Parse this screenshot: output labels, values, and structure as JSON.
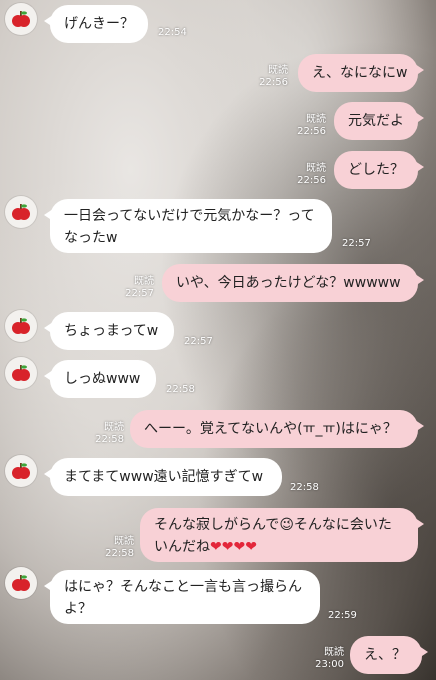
{
  "read_label": "既読",
  "messages": [
    {
      "side": "in",
      "text": "げんきー？",
      "time": "22:54"
    },
    {
      "side": "out",
      "text": "え、なになにw",
      "time": "22:56",
      "read": true
    },
    {
      "side": "out",
      "text": "元気だよ",
      "time": "22:56",
      "read": true
    },
    {
      "side": "out",
      "text": "どした？",
      "time": "22:56",
      "read": true
    },
    {
      "side": "in",
      "text": "一日会ってないだけで元気かなー？ってなったw",
      "time": "22:57"
    },
    {
      "side": "out",
      "text": "いや、今日あったけどな？wwwww",
      "time": "22:57",
      "read": true
    },
    {
      "side": "in",
      "text": "ちょっまってw",
      "time": "22:57"
    },
    {
      "side": "in",
      "text": "しっぬwww",
      "time": "22:58"
    },
    {
      "side": "out",
      "text": "へーー。覚えてないんや(ㅠ_ㅠ)はにゃ？",
      "time": "22:58",
      "read": true
    },
    {
      "side": "in",
      "text": "まてまてwww遠い記憶すぎてw",
      "time": "22:58"
    },
    {
      "side": "out",
      "text": "そんな寂しがらんで😉そんなに会いたいんだね❤️❤️❤️❤️",
      "time": "22:58",
      "read": true
    },
    {
      "side": "in",
      "text": "はにゃ？そんなこと一言も言っ撮らんよ？",
      "time": "22:59"
    },
    {
      "side": "out",
      "text": "え、？",
      "time": "23:00",
      "read": true
    }
  ],
  "msg_texts": {
    "m0": "げんきー？",
    "m1": "え、なになにw",
    "m2": "元気だよ",
    "m3": "どした？",
    "m4a": "一日会ってないだけで元気かなー？って",
    "m4b": "なったw",
    "m5": "いや、今日あったけどな？wwwww",
    "m6": "ちょっまってw",
    "m7": "しっぬwww",
    "m8": "へーー。覚えてないんや(ㅠ_ㅠ)はにゃ？",
    "m9": "まてまてwww遠い記憶すぎてw",
    "m10a": "そんな寂しがらんで",
    "m10emoji": "😉",
    "m10b": "そんなに会いた",
    "m10c": "いんだね",
    "m10hearts": "❤❤❤❤",
    "m11a": "はにゃ？そんなこと一言も言っ撮らん",
    "m11b": "よ？",
    "m12": "え、？"
  },
  "times": {
    "t0": "22:54",
    "t1": "22:56",
    "t2": "22:56",
    "t3": "22:56",
    "t4": "22:57",
    "t5": "22:57",
    "t6": "22:57",
    "t7": "22:58",
    "t8": "22:58",
    "t9": "22:58",
    "t10": "22:58",
    "t11": "22:59",
    "t12": "23:00"
  },
  "avatar_icon": "apple-icon",
  "colors": {
    "incoming_bubble": "#ffffff",
    "outgoing_bubble": "#f8d1d6",
    "heart": "#e3263a"
  }
}
